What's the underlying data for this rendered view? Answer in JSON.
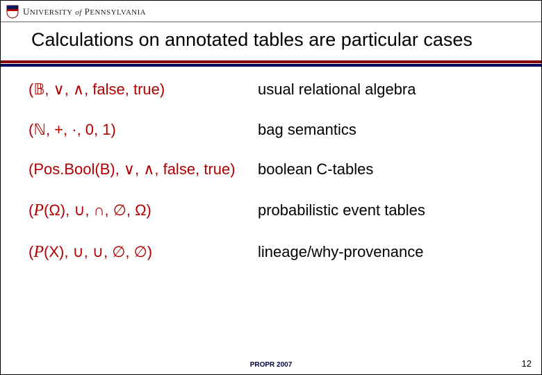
{
  "header": {
    "university_name_html": "U<small>NIVERSITY</small> <span class=\"of\">of</span> P<small>ENNSYLVANIA</small>"
  },
  "title": "Calculations on annotated tables are particular cases",
  "rows": [
    {
      "left_html": "(<span class=\"bb\">𝔹</span>, ∨, ∧, false, true)",
      "right": "usual relational algebra"
    },
    {
      "left_html": "(<span class=\"bb\">ℕ</span>, +, ·, 0, 1)",
      "right": "bag semantics"
    },
    {
      "left_html": "(Pos.Bool(B), ∨, ∧, false, true)",
      "right": "boolean C-tables"
    },
    {
      "left_html": "(<span class=\"script\">P</span>(Ω), ∪, ∩, ∅, Ω)",
      "right": "probabilistic event tables"
    },
    {
      "left_html": "(<span class=\"script\">P</span>(X), ∪, ∪, ∅, ∅)",
      "right": "lineage/why-provenance"
    }
  ],
  "footer": {
    "venue": "PROPR 2007",
    "page": "12"
  }
}
